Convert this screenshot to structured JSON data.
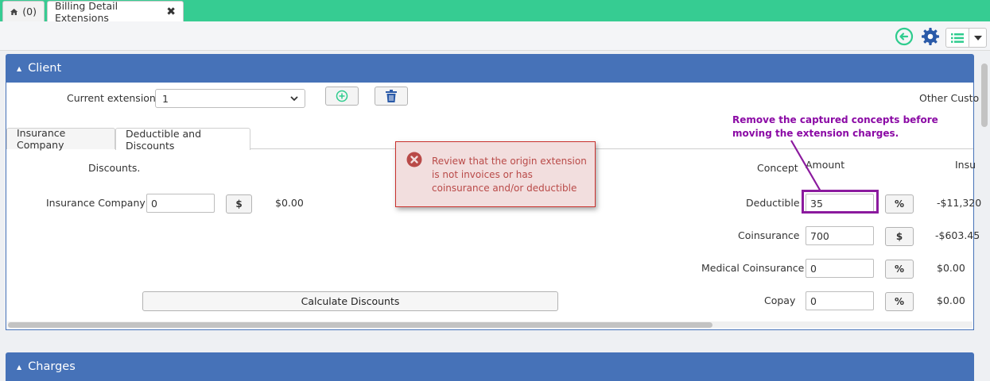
{
  "top_tabs": {
    "home": {
      "label": "(0)",
      "icon": "home-icon"
    },
    "billing": {
      "label": "Billing Detail Extensions",
      "close": "✖"
    }
  },
  "colors": {
    "topbar": "#36cc92",
    "panel_header": "#4672b8",
    "alert_bg": "#f2dede",
    "alert_text": "#b94a48",
    "annotation": "#8b0aa5",
    "icon_green": "#2ecc8e",
    "icon_blue": "#2a5aa8"
  },
  "toolbar": {
    "icons": [
      "back-arrow-icon",
      "gear-icon",
      "list-icon",
      "caret-down-icon"
    ]
  },
  "client_panel": {
    "title": "Client",
    "current_extension_label": "Current extension",
    "current_extension_value": "1",
    "other_customers_label": "Other Custo",
    "tabs": [
      {
        "label": "Insurance Company",
        "active": false
      },
      {
        "label": "Deductible and Discounts",
        "active": true
      }
    ],
    "discounts": {
      "heading": "Discounts.",
      "insurance_company_label": "Insurance Company",
      "insurance_company_value": "0",
      "unit": "$",
      "amount": "$0.00",
      "calculate_label": "Calculate Discounts"
    },
    "concepts": {
      "concept_header": "Concept",
      "amount_header": "Amount",
      "insu_header": "Insu",
      "rows": [
        {
          "label": "Deductible",
          "value": "35",
          "unit": "%",
          "result": "-$11,320"
        },
        {
          "label": "Coinsurance",
          "value": "700",
          "unit": "$",
          "result": "-$603.45"
        },
        {
          "label": "Medical Coinsurance",
          "value": "0",
          "unit": "%",
          "result": "$0.00"
        },
        {
          "label": "Copay",
          "value": "0",
          "unit": "%",
          "result": "$0.00"
        }
      ]
    }
  },
  "alert": {
    "icon": "error-x-icon",
    "message": "Review that the origin extension is not invoices or has coinsurance and/or deductible"
  },
  "annotation": {
    "text": "Remove the captured concepts before moving the extension charges."
  },
  "charges_panel": {
    "title": "Charges"
  }
}
